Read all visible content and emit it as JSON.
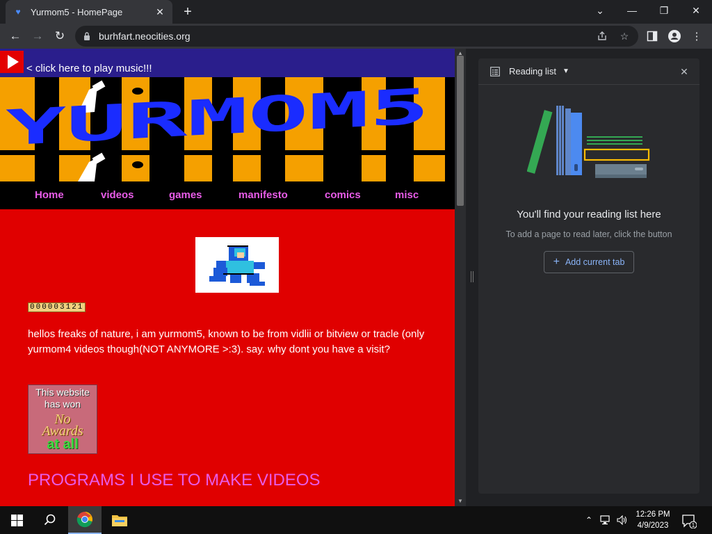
{
  "browser": {
    "tab": {
      "title": "Yurmom5 - HomePage",
      "favicon": "neocities-favicon"
    },
    "url": "burhfart.neocities.org"
  },
  "page": {
    "music_link": "< click here to play music!!!",
    "banner_text": "YURMOM5",
    "nav": [
      "Home",
      "videos",
      "games",
      "manifesto",
      "comics",
      "misc"
    ],
    "counter": "000003121",
    "intro": "hellos freaks of nature, i am yurmom5, known to be from vidlii or bitview or tracle (only yurmom4 videos though(NOT ANYMORE >:3). say. why dont you have a visit?",
    "award": {
      "line1": "This website",
      "line2": "has won",
      "line3": "No",
      "line4": "Awards",
      "line5": "at all"
    },
    "programs_heading": "PROGRAMS I USE TO MAKE VIDEOS"
  },
  "reading_list": {
    "title": "Reading list",
    "empty_title": "You'll find your reading list here",
    "empty_subtitle": "To add a page to read later, click the button",
    "add_button": "Add current tab"
  },
  "taskbar": {
    "time": "12:26 PM",
    "date": "4/9/2023",
    "notification_count": "1"
  },
  "colors": {
    "page_bg": "#e00000",
    "nav_link": "#e85ce8",
    "music_bar": "#2a1e8c",
    "accent_blue": "#8ab4f8"
  }
}
